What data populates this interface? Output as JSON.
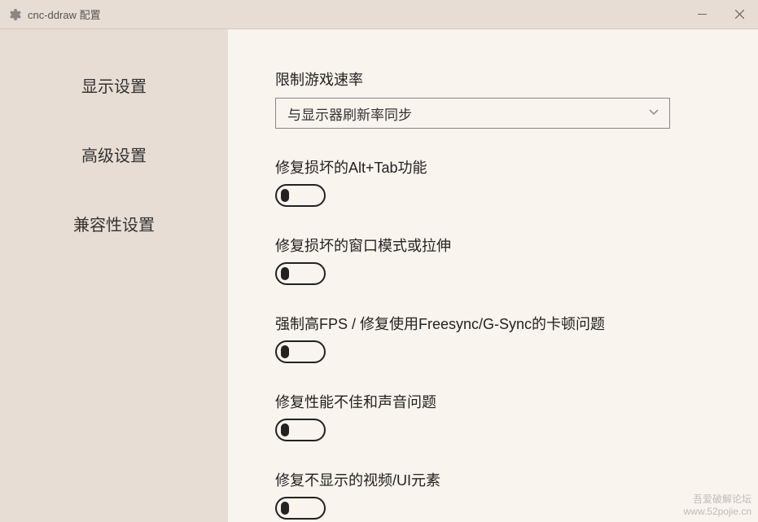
{
  "window": {
    "title": "cnc-ddraw 配置"
  },
  "sidebar": {
    "items": [
      {
        "label": "显示设置"
      },
      {
        "label": "高级设置"
      },
      {
        "label": "兼容性设置"
      }
    ]
  },
  "settings": {
    "limit_speed": {
      "label": "限制游戏速率",
      "selected": "与显示器刷新率同步"
    },
    "fix_alt_tab": {
      "label": "修复损坏的Alt+Tab功能",
      "value": false
    },
    "fix_window_mode": {
      "label": "修复损坏的窗口模式或拉伸",
      "value": false
    },
    "force_high_fps": {
      "label": "强制高FPS / 修复使用Freesync/G-Sync的卡顿问题",
      "value": false
    },
    "fix_performance_sound": {
      "label": "修复性能不佳和声音问题",
      "value": false
    },
    "fix_hidden_video_ui": {
      "label": "修复不显示的视频/UI元素",
      "value": false
    }
  },
  "watermark": {
    "line1": "吾爱破解论坛",
    "line2": "www.52pojie.cn"
  }
}
